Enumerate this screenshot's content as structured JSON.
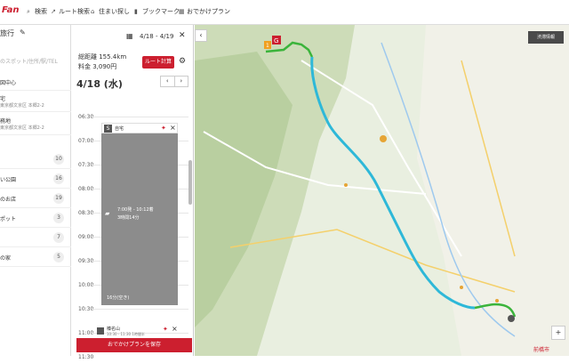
{
  "header": {
    "logo": "Fan",
    "nav": [
      "検索",
      "ルート検索",
      "住まい探し",
      "ブックマーク",
      "おでかけプラン"
    ]
  },
  "left": {
    "title": "旅行",
    "search_placeholder": "のスポット/住所/駅/TEL",
    "center_label": "図中心",
    "home": {
      "name": "宅",
      "addr": "東京都文京区 本郷2-2"
    },
    "work": {
      "name": "務地",
      "addr": "東京都文京区 本郷2-2"
    },
    "categories": [
      {
        "label": "",
        "count": "10"
      },
      {
        "label": "い公園",
        "count": "16"
      },
      {
        "label": "のお店",
        "count": "19"
      },
      {
        "label": "ポット",
        "count": "3"
      },
      {
        "label": "",
        "count": "7"
      },
      {
        "label": "の家",
        "count": "5"
      }
    ]
  },
  "plan": {
    "dates": "4/18 - 4/19",
    "distance": "総距離 155.4km",
    "toll": "料金 3,090円",
    "route_button": "ルート計算",
    "day": "4/18 (水)",
    "times": [
      "06:30",
      "07:00",
      "07:30",
      "08:00",
      "08:30",
      "09:00",
      "09:30",
      "10:00",
      "10:30",
      "11:00",
      "11:30"
    ],
    "start": "自宅",
    "drive_time": "7:00発 - 10:12着",
    "drive_dur": "3時間14分",
    "free": "16分(空き)",
    "next_name": "榛名山",
    "next_time": "10:30 - 11:30 1時間半",
    "save_button": "おでかけプランを保存"
  },
  "map": {
    "traffic": "渋滞情報",
    "scale": "前橋市",
    "colors": {
      "route_blue": "#2eb8d8",
      "route_green": "#3bb43b",
      "accent": "#cc1f2f"
    }
  }
}
